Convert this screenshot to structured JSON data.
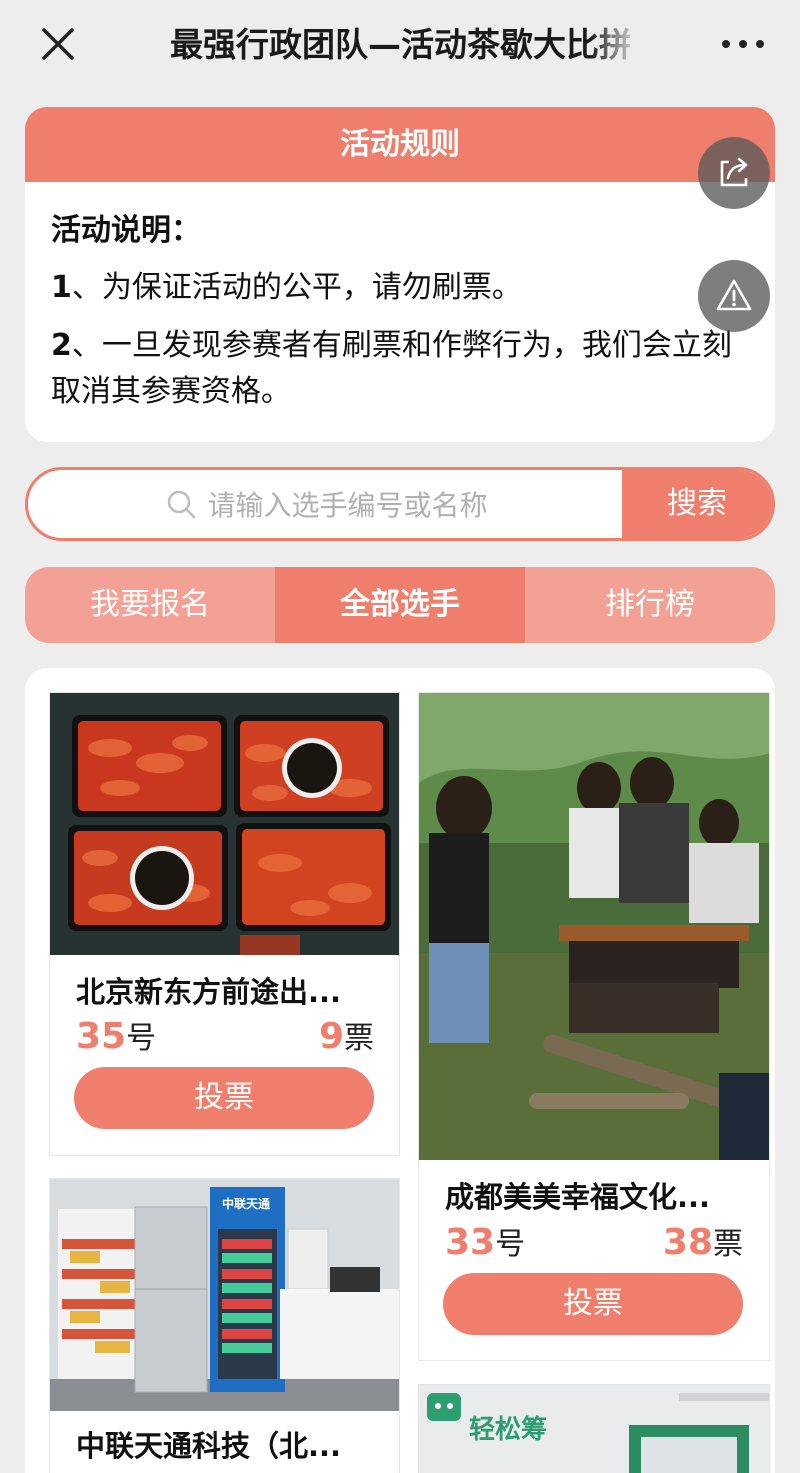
{
  "nav": {
    "title": "最强行政团队—活动茶歇大比拼"
  },
  "rules": {
    "header": "活动规则",
    "heading": "活动说明：",
    "items": [
      {
        "num": "1",
        "text": "、为保证活动的公平，请勿刷票。"
      },
      {
        "num": "2",
        "text": "、一旦发现参赛者有刷票和作弊行为，我们会立刻取消其参赛资格。"
      }
    ]
  },
  "search": {
    "placeholder": "请输入选手编号或名称",
    "button": "搜索"
  },
  "tabs": [
    {
      "label": "我要报名",
      "active": false
    },
    {
      "label": "全部选手",
      "active": true
    },
    {
      "label": "排行榜",
      "active": false
    }
  ],
  "contestants": [
    {
      "title": "北京新东方前途出...",
      "number": "35",
      "number_unit": "号",
      "votes": "9",
      "votes_unit": "票",
      "vote_label": "投票",
      "image": "crayfish-trays-photo"
    },
    {
      "title": "成都美美幸福文化...",
      "number": "33",
      "number_unit": "号",
      "votes": "38",
      "votes_unit": "票",
      "vote_label": "投票",
      "image": "outdoor-bbq-group-photo"
    },
    {
      "title": "中联天通科技（北...",
      "image": "office-pantry-photo",
      "image_logo_text": "中联天通"
    },
    {
      "image": "office-interior-photo",
      "image_sign_text": "轻松筹"
    }
  ],
  "colors": {
    "accent": "#ef7e6d",
    "accent_light": "#f3a195",
    "background": "#ededed"
  },
  "icons": {
    "close": "close-icon",
    "more": "more-icon",
    "share": "share-icon",
    "report": "warning-icon",
    "search": "search-icon"
  }
}
